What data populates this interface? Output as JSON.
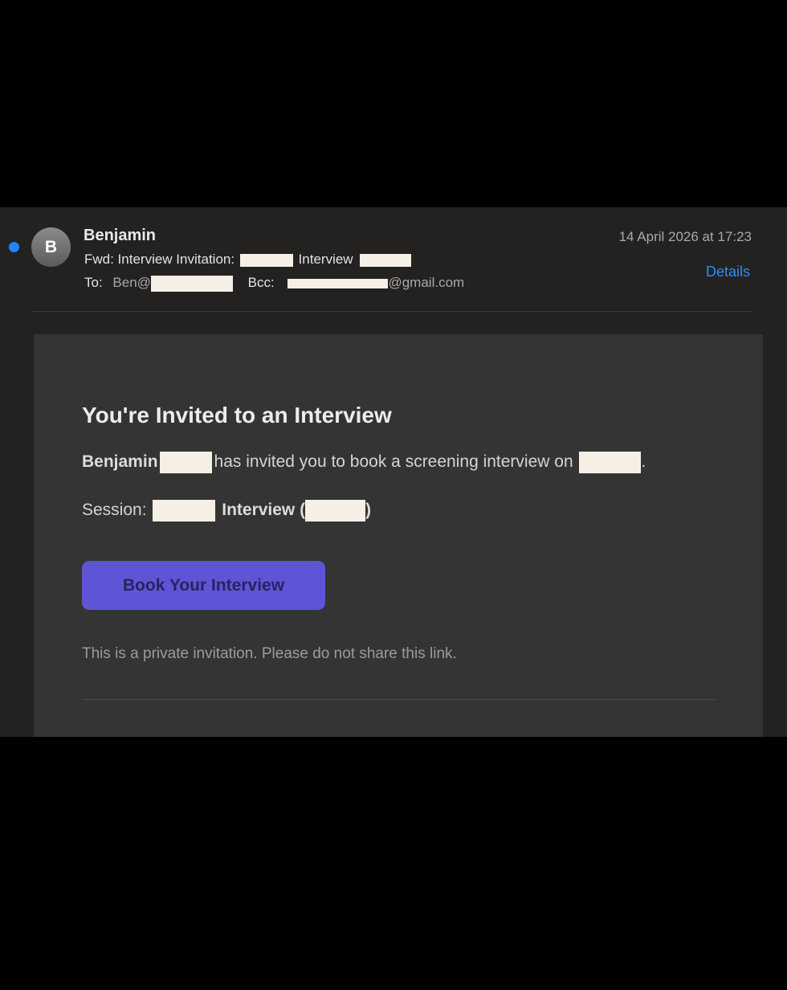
{
  "header": {
    "avatar_initial": "B",
    "sender": "Benjamin",
    "subject_prefix": "Fwd: Interview Invitation:",
    "subject_middle": "Interview",
    "to_label": "To:",
    "to_value": "Ben@",
    "bcc_label": "Bcc:",
    "bcc_suffix": "@gmail.com",
    "date": "14 April 2026 at 17:23",
    "details_label": "Details"
  },
  "body": {
    "headline": "You're Invited to an Interview",
    "inviter": "Benjamin",
    "invite_text": "has invited you to book a screening interview on",
    "period": ".",
    "session_label": "Session:",
    "session_interview": "Interview (",
    "session_close": ")",
    "button_label": "Book Your Interview",
    "private_note": "This is a private invitation. Please do not share this link."
  },
  "colors": {
    "unread_dot": "#1f86ff",
    "link_blue": "#2f8cf0",
    "button_purple": "#5d55d6"
  }
}
